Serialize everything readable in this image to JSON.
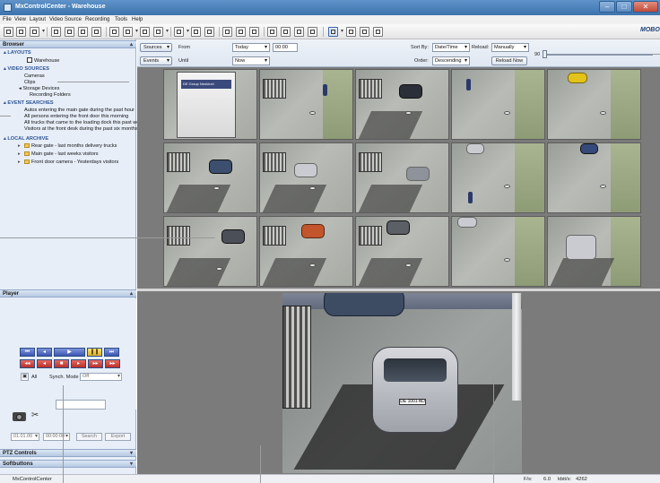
{
  "window": {
    "title": "MxControlCenter - Warehouse"
  },
  "menu": [
    "File",
    "View",
    "Layout",
    "Video Source",
    "Recording",
    "Tools",
    "Help"
  ],
  "browser": {
    "title": "Browser",
    "layouts": {
      "label": "LAYOUTS",
      "items": [
        "Warehouse"
      ]
    },
    "video_sources": {
      "label": "VIDEO SOURCES",
      "items": [
        "Cameras",
        "Clips",
        "Storage Devices",
        "Recording Folders"
      ]
    },
    "event_searches": {
      "label": "EVENT SEARCHES",
      "items": [
        "Autos entering the main gate during the past hour",
        "All persons entering the front door this morning",
        "All trucks that came to the loading dock this past week",
        "Visitors at the front desk during the past six months"
      ]
    },
    "local_archive": {
      "label": "LOCAL ARCHIVE",
      "items": [
        "Rear gate - last months delivery trucks",
        "Main gate - last weeks visitors",
        "Front door camera - Yesterdays visitors"
      ]
    }
  },
  "player": {
    "title": "Player",
    "all_label": "All",
    "synch_label": "Synch. Mode",
    "synch_value": "Off",
    "date_value": "01.01.00",
    "time_value": "00:00:00",
    "search_label": "Search",
    "export_label": "Export"
  },
  "ptz": {
    "title": "PTZ Controls"
  },
  "softbuttons": {
    "title": "Softbuttons"
  },
  "filter": {
    "sources_btn": "Sources",
    "events_btn": "Events",
    "from_label": "From",
    "until_label": "Until",
    "from_value": "Today",
    "from_time": "00:00",
    "until_value": "Now",
    "sortby_label": "Sort By:",
    "sortby_value": "Date/Time",
    "order_label": "Order:",
    "order_value": "Descending",
    "reload_label": "Reload:",
    "reload_value": "Manually",
    "reload_now": "Reload Now",
    "slider_value_label": "90"
  },
  "bigview": {
    "plate": "DE 1001 AD"
  },
  "truck_text": "DE Group Neukirch",
  "status": {
    "app": "MxControlCenter",
    "fps_label": "F/s:",
    "fps_value": "6.0",
    "kbits_label": "kbit/s:",
    "kbits_value": "4262"
  },
  "logo": "MOBO"
}
